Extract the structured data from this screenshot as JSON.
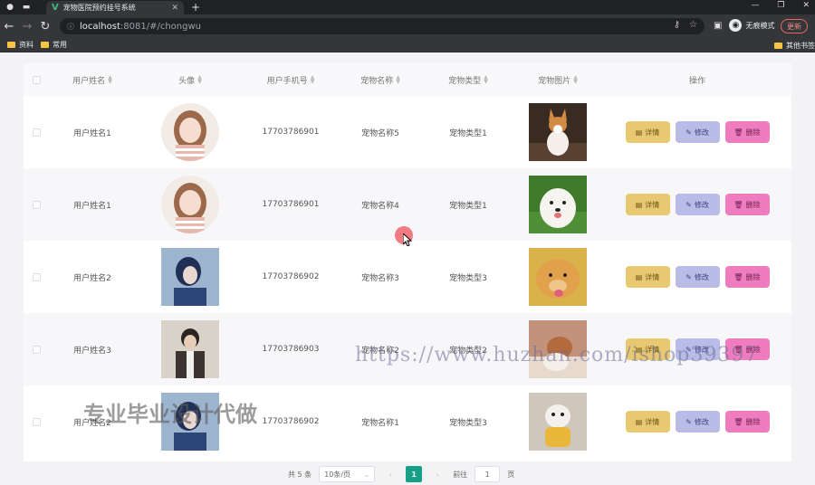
{
  "browser": {
    "tab_title": "宠物医院预约挂号系统",
    "url_host": "localhost",
    "url_path": ":8081/#/chongwu",
    "incognito_label": "无痕模式",
    "update_label": "更新",
    "bookmarks": [
      "资料",
      "常用"
    ],
    "bookmarks_right": "其他书签"
  },
  "table": {
    "headers": {
      "username": "用户姓名",
      "avatar": "头像",
      "phone": "用户手机号",
      "pet_name": "宠物名称",
      "pet_type": "宠物类型",
      "pet_image": "宠物图片",
      "actions": "操作"
    },
    "rows": [
      {
        "username": "用户姓名1",
        "avatar": "girl",
        "phone": "17703786901",
        "pet_name": "宠物名称5",
        "pet_type": "宠物类型1",
        "pet_image": "corgi"
      },
      {
        "username": "用户姓名1",
        "avatar": "girl",
        "phone": "17703786901",
        "pet_name": "宠物名称4",
        "pet_type": "宠物类型1",
        "pet_image": "white-dog"
      },
      {
        "username": "用户姓名2",
        "avatar": "blue-boy",
        "phone": "17703786902",
        "pet_name": "宠物名称3",
        "pet_type": "宠物类型3",
        "pet_image": "golden-dog"
      },
      {
        "username": "用户姓名3",
        "avatar": "man-photo",
        "phone": "17703786903",
        "pet_name": "宠物名称2",
        "pet_type": "宠物类型2",
        "pet_image": "brown-dog"
      },
      {
        "username": "用户姓名2",
        "avatar": "blue-boy",
        "phone": "17703786902",
        "pet_name": "宠物名称1",
        "pet_type": "宠物类型3",
        "pet_image": "puppy-yellow"
      }
    ],
    "buttons": {
      "detail": "详情",
      "edit": "修改",
      "delete": "删除"
    }
  },
  "pagination": {
    "total": "共 5 条",
    "page_size": "10条/页",
    "current_page": "1",
    "goto_prefix": "前往",
    "goto_value": "1",
    "goto_suffix": "页"
  },
  "watermarks": {
    "url": "https://www.huzhan.com/ishop39397",
    "text": "专业毕业设计代做"
  },
  "colors": {
    "detail_button": "#e8c870",
    "edit_button": "#b8bce6",
    "delete_button": "#f07cc0",
    "active_page": "#16a085"
  }
}
